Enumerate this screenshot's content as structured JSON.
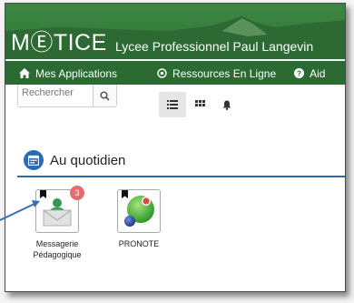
{
  "header": {
    "brand": "MⒺTICE",
    "school": "Lycee Professionnel Paul Langevin"
  },
  "tabs": [
    {
      "label": "Mes Applications",
      "icon": "home-icon",
      "active": true
    },
    {
      "label": "Ressources En Ligne",
      "icon": "target-icon",
      "active": false
    },
    {
      "label": "Aid",
      "icon": "question-icon",
      "active": false
    }
  ],
  "search": {
    "placeholder": "Rechercher"
  },
  "views": [
    "list-view-icon",
    "grid-view-icon",
    "bell-icon"
  ],
  "section": {
    "title": "Au quotidien",
    "icon": "calendar-icon"
  },
  "apps": [
    {
      "name": "Messagerie Pédagogique",
      "line1": "Messagerie",
      "line2": "Pédagogique",
      "badge": "3",
      "icon": "mail-user-icon"
    },
    {
      "name": "PRONOTE",
      "line1": "PRONOTE",
      "line2": "",
      "icon": "pronote-icon"
    }
  ],
  "colors": {
    "header_green": "#2e6e34",
    "accent_blue": "#2e6bb0",
    "badge_red": "#e26d6d"
  }
}
